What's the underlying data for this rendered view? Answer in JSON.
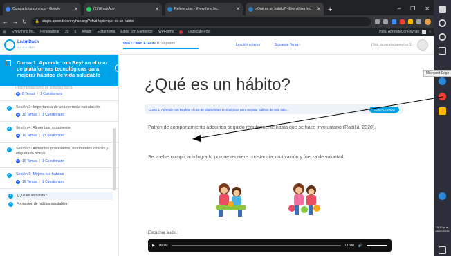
{
  "browser": {
    "tabs": [
      {
        "title": "Compartidos conmigo - Google",
        "active": false
      },
      {
        "title": "(1) WhatsApp",
        "active": false
      },
      {
        "title": "Referencias - Everything Inc.",
        "active": false
      },
      {
        "title": "¿Qué es un hábito? - Everything Inc.",
        "active": true
      }
    ],
    "url": "stagin.aprendeconreyhan.org/?sfwd-topic=que-es-un-habito"
  },
  "adminbar": {
    "site": "Everything Inc.",
    "customize": "Personalizar",
    "updates": "20",
    "comments": "0",
    "add": "Añadir",
    "edit_theme": "Editar tema",
    "edit_elementor": "Editar con Elementor",
    "wpforms": "WPForms",
    "duplicate": "Duplicate Post",
    "greeting": "Hola, AprendeConReyhan"
  },
  "header": {
    "logo_name": "LearnDash",
    "logo_sub": "ACADEMY",
    "progress_percent": "99% COMPLETADO",
    "progress_steps": "11/12 pasos",
    "progress_fraction": 0.99,
    "prev_label": "Lección anterior",
    "next_label": "Siguiente Tema",
    "user_name": "Hola, aprendeconreyhan1"
  },
  "sidebar": {
    "course_title": "Curso 1: Aprende con Reyhan el uso de plataformas tecnológicas para mejorar hábitos de vida saludable",
    "cut_text": "Recomendaciones de actividad física",
    "first_meta_temas": "8 Temas",
    "first_meta_quiz": "1 Cuestionario",
    "sections": [
      {
        "title": "Sesión 3: Importancia de una correcta hidratación",
        "temas": "10 Temas",
        "quiz": "1 Cuestionario",
        "highlight": false
      },
      {
        "title": "Sesión 4: Aliméntate sanamente",
        "temas": "10 Temas",
        "quiz": "1 Cuestionario",
        "highlight": false
      },
      {
        "title": "Sesión 5: Alimentos procesados, nutrimentos críticos y etiquetado frontal",
        "temas": "10 Temas",
        "quiz": "1 Cuestionario",
        "highlight": false
      },
      {
        "title": "Sesión 6: Mejora tus hábitos",
        "temas": "16 Temas",
        "quiz": "1 Cuestionario",
        "highlight": true
      }
    ],
    "topics": [
      "¿Qué es un hábito?",
      "Formación de hábitos saludables"
    ]
  },
  "main": {
    "title": "¿Qué es un hábito?",
    "crumb": "Curso 1: Aprende con Reyhan el uso de plataformas tecnológicas para mejorar hábitos de vida salu...",
    "crumb_badge": "COMPLETADO",
    "paragraph1": "Patrón de comportamiento adquirido seguido regularmente hasta que se hace involuntario (Radilla, 2020).",
    "paragraph2": "Se vuelve complicado lograrlo porque requiere constancia, motivación y fuerza de voluntad.",
    "audio_label": "Escuchar audio:",
    "audio_start": "00:00",
    "audio_end": "00:00"
  },
  "taskbar": {
    "tooltip": "Microsoft Edge",
    "time": "10:10 p. m.",
    "date": "06/02/2022"
  },
  "colors": {
    "accent": "#00a2e8",
    "link": "#235af3",
    "chrome_dark": "#202124"
  }
}
